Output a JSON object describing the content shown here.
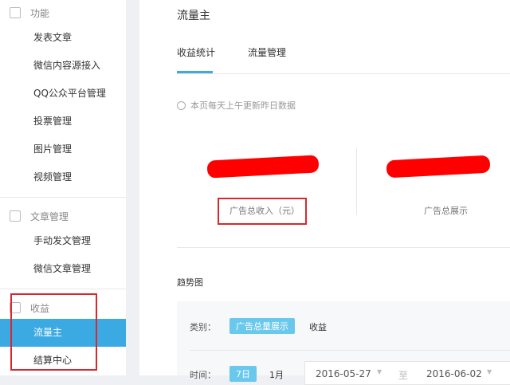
{
  "sidebar": {
    "group1": "功能",
    "items1": [
      "发表文章",
      "微信内容源接入",
      "QQ公众平台管理",
      "投票管理",
      "图片管理",
      "视频管理"
    ],
    "group2": "文章管理",
    "items2": [
      "手动发文管理",
      "微信文章管理"
    ],
    "group3": "收益",
    "items3": [
      "流量主",
      "结算中心"
    ]
  },
  "header": {
    "title": "流量主"
  },
  "tabs": [
    "收益统计",
    "流量管理"
  ],
  "notice": "本页每天上午更新昨日数据",
  "stats": [
    {
      "label": "广告总收入（元）"
    },
    {
      "label": "广告总展示"
    }
  ],
  "trend": {
    "title": "趋势图",
    "category_label": "类别：",
    "categories": [
      "广告总量展示",
      "收益"
    ],
    "time_label": "时间：",
    "ranges": [
      "7日",
      "1月"
    ],
    "start_date": "2016-05-27",
    "to": "至",
    "end_date": "2016-06-02"
  },
  "colors": {
    "accent": "#3baae3",
    "highlight": "#d9272e"
  }
}
